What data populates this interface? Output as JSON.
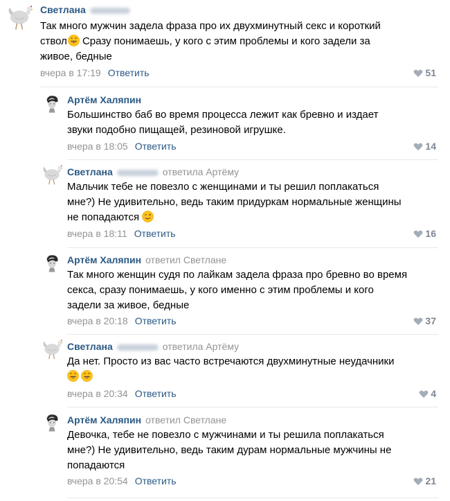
{
  "comments": [
    {
      "author": "Светлана",
      "reply_to": "",
      "lines": [
        "Так много мужчин задела фраза про их двухминутный секс и короткий",
        "ствол",
        "Сразу понимаешь, у кого с этим проблемы и кого задели за",
        "живое, бедные"
      ],
      "time": "вчера в 17:19",
      "reply_label": "Ответить",
      "likes": "51"
    },
    {
      "author": "Артём Халяпин",
      "reply_to": "",
      "lines": [
        "Большинство баб во время процесса лежит как бревно и издает",
        "звуки подобно пищащей, резиновой игрушке."
      ],
      "time": "вчера в 18:05",
      "reply_label": "Ответить",
      "likes": "14"
    },
    {
      "author": "Светлана",
      "reply_to": "ответила Артёму",
      "lines": [
        "Мальчик тебе не повезло с женщинами и ты решил поплакаться",
        "мне?) Не удивительно, ведь таким придуркам нормальные женщины",
        "не попадаются"
      ],
      "time": "вчера в 18:11",
      "reply_label": "Ответить",
      "likes": "16"
    },
    {
      "author": "Артём Халяпин",
      "reply_to": "ответил Светлане",
      "lines": [
        "Так много женщин судя по лайкам задела фраза про бревно во время",
        "секса, сразу понимаешь, у кого именно с этим проблемы и кого",
        "задели за живое, бедные"
      ],
      "time": "вчера в 20:18",
      "reply_label": "Ответить",
      "likes": "37"
    },
    {
      "author": "Светлана",
      "reply_to": "ответила Артёму",
      "lines": [
        "Да нет. Просто из вас часто встречаются двухминутные неудачники"
      ],
      "time": "вчера в 20:34",
      "reply_label": "Ответить",
      "likes": "4"
    },
    {
      "author": "Артём Халяпин",
      "reply_to": "ответил Светлане",
      "lines": [
        "Девочка, тебе не повезло с мужчинами и ты решила поплакаться",
        "мне?) Не удивительно, ведь таким дурам нормальные мужчины не",
        "попадаются"
      ],
      "time": "вчера в 20:54",
      "reply_label": "Ответить",
      "likes": "21"
    }
  ],
  "colors": {
    "author": "#2a5885",
    "meta": "#939393",
    "separator": "#e7e8ec",
    "like": "#7d8793"
  },
  "icons": {
    "chicken_avatar": "chicken-avatar-icon",
    "man_avatar": "man-avatar-icon",
    "like": "heart-icon",
    "smile": "smile-emoji-icon",
    "wink": "wink-emoji-icon"
  }
}
